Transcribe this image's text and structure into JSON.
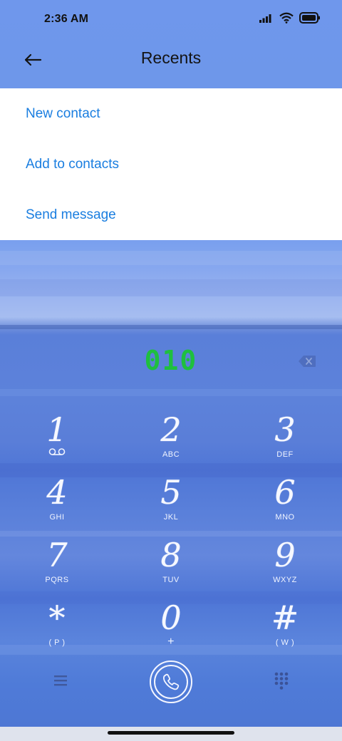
{
  "status_bar": {
    "time": "2:36 AM",
    "icons": [
      "signal-icon",
      "wifi-icon",
      "battery-icon"
    ]
  },
  "header": {
    "title": "Recents",
    "back_icon": "back-arrow-icon"
  },
  "menu": {
    "items": [
      {
        "label": "New contact"
      },
      {
        "label": "Add to contacts"
      },
      {
        "label": "Send message"
      }
    ]
  },
  "dialer": {
    "number": "010",
    "backspace_icon": "backspace-icon"
  },
  "keypad": {
    "keys": [
      {
        "digit": "1",
        "letters": ""
      },
      {
        "digit": "2",
        "letters": "ABC"
      },
      {
        "digit": "3",
        "letters": "DEF"
      },
      {
        "digit": "4",
        "letters": "GHI"
      },
      {
        "digit": "5",
        "letters": "JKL"
      },
      {
        "digit": "6",
        "letters": "MNO"
      },
      {
        "digit": "7",
        "letters": "PQRS"
      },
      {
        "digit": "8",
        "letters": "TUV"
      },
      {
        "digit": "9",
        "letters": "WXYZ"
      },
      {
        "digit": "*",
        "letters": "( P )"
      },
      {
        "digit": "0",
        "letters": "+"
      },
      {
        "digit": "#",
        "letters": "( W )"
      }
    ]
  },
  "bottom_bar": {
    "menu_icon": "menu-lines-icon",
    "call_icon": "phone-icon",
    "dialpad_icon": "dialpad-icon"
  },
  "colors": {
    "accent": "#1a7ee0",
    "number": "#1fbf3e",
    "header_bg": "#6f97ec"
  }
}
